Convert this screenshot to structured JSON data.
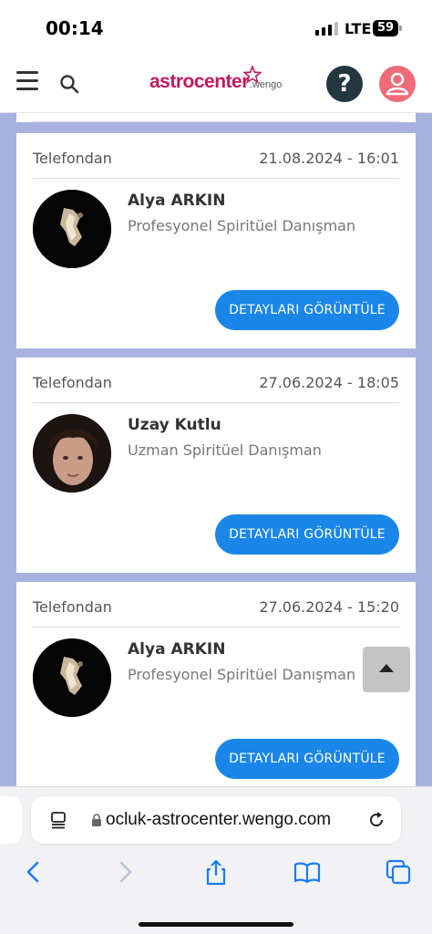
{
  "status": {
    "time": "00:14",
    "network": "LTE",
    "battery": "59"
  },
  "header": {
    "logo_main": "astrocenter",
    "logo_sub": ".wengo",
    "help_label": "?"
  },
  "consultations": [
    {
      "type": "Telefondan",
      "datetime": "21.08.2024 - 16:01",
      "name": "Alya ARKIN",
      "title": "Profesyonel Spiritüel Danışman",
      "button": "DETAYLARI GÖRÜNTÜLE"
    },
    {
      "type": "Telefondan",
      "datetime": "27.06.2024 - 18:05",
      "name": "Uzay Kutlu",
      "title": "Uzman Spiritüel Danışman",
      "button": "DETAYLARI GÖRÜNTÜLE"
    },
    {
      "type": "Telefondan",
      "datetime": "27.06.2024 - 15:20",
      "name": "Alya ARKIN",
      "title": "Profesyonel Spiritüel Danışman",
      "button": "DETAYLARI GÖRÜNTÜLE"
    }
  ],
  "browser": {
    "url": "ocluk-astrocenter.wengo.com"
  },
  "colors": {
    "brand": "#c2195b",
    "button": "#1a86e8",
    "background": "#a8b2e0",
    "help": "#24363f",
    "user": "#f06b7a"
  },
  "icons": [
    "hamburger-icon",
    "search-icon",
    "help-icon",
    "user-icon",
    "reader-icon",
    "lock-icon",
    "reload-icon",
    "back-icon",
    "forward-icon",
    "share-icon",
    "bookmarks-icon",
    "tabs-icon",
    "scroll-top-icon"
  ]
}
